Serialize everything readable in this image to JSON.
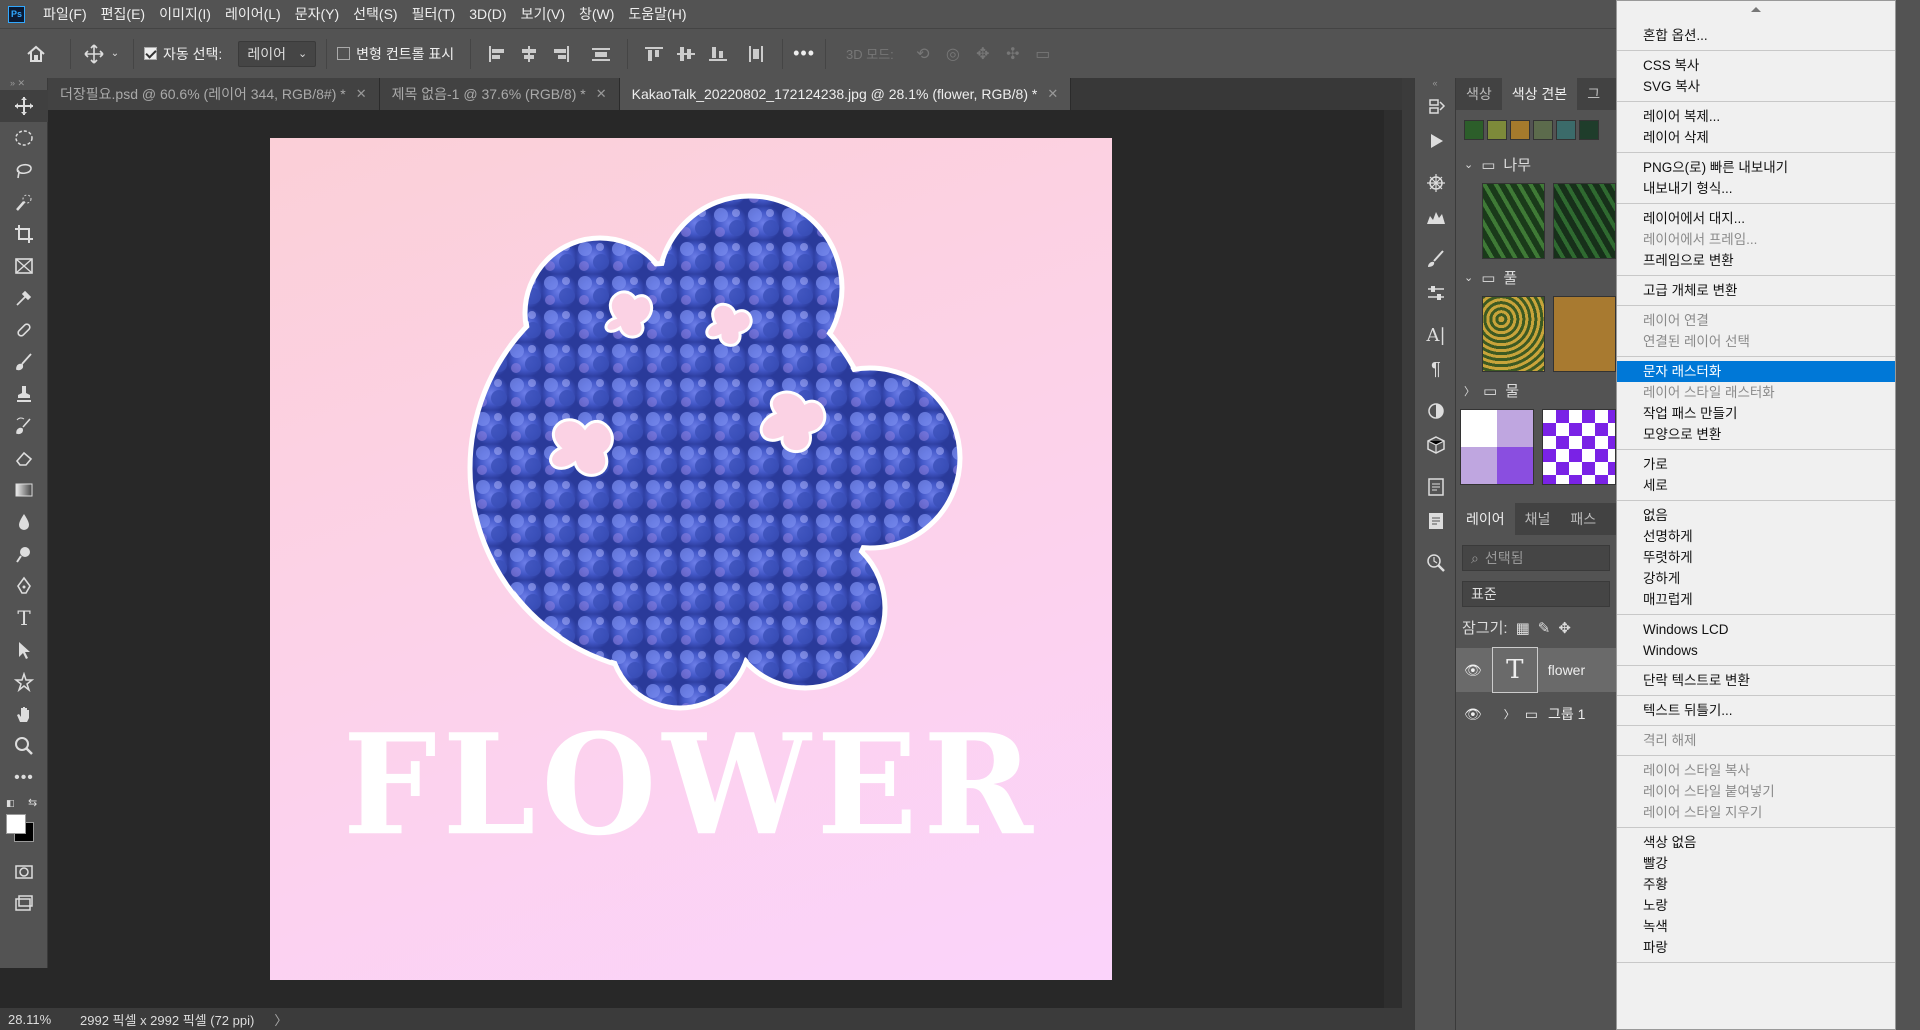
{
  "menubar": {
    "logo": "Ps",
    "items": [
      "파일(F)",
      "편집(E)",
      "이미지(I)",
      "레이어(L)",
      "문자(Y)",
      "선택(S)",
      "필터(T)",
      "3D(D)",
      "보기(V)",
      "창(W)",
      "도움말(H)"
    ]
  },
  "options": {
    "auto_select_label": "자동 선택:",
    "auto_select_value": "레이어",
    "transform_controls_label": "변형 컨트롤 표시",
    "mode_3d_label": "3D 모드:",
    "more": "•••"
  },
  "tabs": [
    {
      "label": "더장필요.psd @ 60.6% (레이어 344, RGB/8#) *",
      "active": false
    },
    {
      "label": "제목 없음-1 @ 37.6% (RGB/8) *",
      "active": false
    },
    {
      "label": "KakaoTalk_20220802_172124238.jpg @ 28.1% (flower, RGB/8) *",
      "active": true
    }
  ],
  "canvas": {
    "text": "FLOWER"
  },
  "status": {
    "zoom": "28.11%",
    "info": "2992 픽셀 x 2992 픽셀 (72 ppi)",
    "arrow": "〉"
  },
  "panel": {
    "top_tabs": [
      "색상",
      "색상 견본",
      "그"
    ],
    "folders": [
      "나무",
      "풀",
      "물"
    ],
    "layer_tabs": [
      "레이어",
      "채널",
      "패스"
    ],
    "search_placeholder": "선택됨",
    "blend_mode": "표준",
    "lock_label": "잠그기:",
    "layers": [
      {
        "name": "flower",
        "type": "text"
      },
      {
        "name": "그룹 1",
        "type": "group"
      }
    ]
  },
  "context_menu": {
    "groups": [
      [
        {
          "label": "혼합 옵션...",
          "enabled": true
        }
      ],
      [
        {
          "label": "CSS 복사",
          "enabled": true
        },
        {
          "label": "SVG 복사",
          "enabled": true
        }
      ],
      [
        {
          "label": "레이어 복제...",
          "enabled": true
        },
        {
          "label": "레이어 삭제",
          "enabled": true
        }
      ],
      [
        {
          "label": "PNG으(로) 빠른 내보내기",
          "enabled": true
        },
        {
          "label": "내보내기 형식...",
          "enabled": true
        }
      ],
      [
        {
          "label": "레이어에서 대지...",
          "enabled": true
        },
        {
          "label": "레이어에서 프레임...",
          "enabled": false
        },
        {
          "label": "프레임으로 변환",
          "enabled": true
        }
      ],
      [
        {
          "label": "고급 개체로 변환",
          "enabled": true
        }
      ],
      [
        {
          "label": "레이어 연결",
          "enabled": false
        },
        {
          "label": "연결된 레이어 선택",
          "enabled": false
        }
      ],
      [
        {
          "label": "문자 래스터화",
          "enabled": true,
          "highlighted": true
        },
        {
          "label": "레이어 스타일 래스터화",
          "enabled": false
        },
        {
          "label": "작업 패스 만들기",
          "enabled": true
        },
        {
          "label": "모양으로 변환",
          "enabled": true
        }
      ],
      [
        {
          "label": "가로",
          "enabled": true
        },
        {
          "label": "세로",
          "enabled": true
        }
      ],
      [
        {
          "label": "없음",
          "enabled": true
        },
        {
          "label": "선명하게",
          "enabled": true
        },
        {
          "label": "뚜렷하게",
          "enabled": true
        },
        {
          "label": "강하게",
          "enabled": true
        },
        {
          "label": "매끄럽게",
          "enabled": true
        }
      ],
      [
        {
          "label": "Windows LCD",
          "enabled": true
        },
        {
          "label": "Windows",
          "enabled": true
        }
      ],
      [
        {
          "label": "단락 텍스트로 변환",
          "enabled": true
        }
      ],
      [
        {
          "label": "텍스트 뒤틀기...",
          "enabled": true
        }
      ],
      [
        {
          "label": "격리 해제",
          "enabled": false
        }
      ],
      [
        {
          "label": "레이어 스타일 복사",
          "enabled": false
        },
        {
          "label": "레이어 스타일 붙여넣기",
          "enabled": false
        },
        {
          "label": "레이어 스타일 지우기",
          "enabled": false
        }
      ],
      [
        {
          "label": "색상 없음",
          "enabled": true
        },
        {
          "label": "빨강",
          "enabled": true
        },
        {
          "label": "주황",
          "enabled": true
        },
        {
          "label": "노랑",
          "enabled": true
        },
        {
          "label": "녹색",
          "enabled": true
        },
        {
          "label": "파랑",
          "enabled": true
        }
      ]
    ]
  },
  "colors": {
    "accent": "#0078d7",
    "canvas_top": "#fbcfd7",
    "canvas_bottom": "#fbd3fb",
    "flower": "#4a5fd0"
  }
}
